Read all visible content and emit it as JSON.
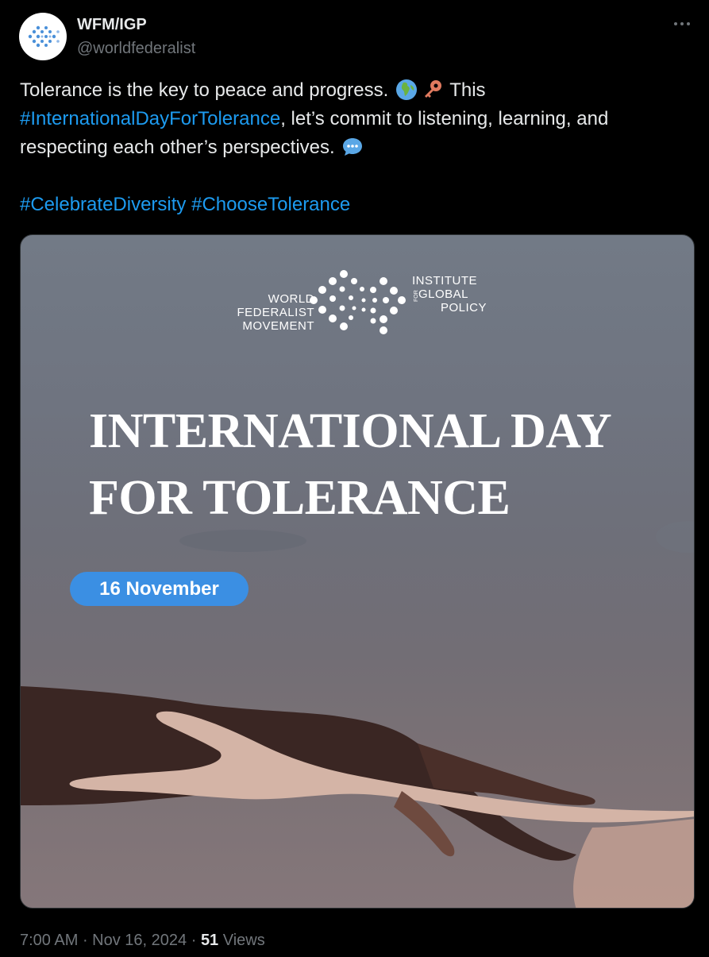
{
  "account": {
    "display_name": "WFM/IGP",
    "handle": "@worldfederalist"
  },
  "icons": {
    "avatar": "wfm-igp-logo-icon",
    "more": "more-options-icon",
    "emoji_1": "globe-africa-europe-icon",
    "emoji_2": "key-icon",
    "emoji_3": "speech-balloon-icon"
  },
  "text": {
    "line1_a": "Tolerance is the key to peace and progress.",
    "line1_b": "This",
    "line2_hashtag": "#InternationalDayForTolerance",
    "line2_rest": ", let’s commit to listening, learning, and",
    "line3": "respecting each other’s perspectives.",
    "hashtag_1": "#CelebrateDiversity",
    "hashtag_2": "#ChooseTolerance"
  },
  "media": {
    "logo_left_1": "WORLD",
    "logo_left_2": "FEDERALIST",
    "logo_left_3": "MOVEMENT",
    "logo_right_1": "INSTITUTE",
    "logo_right_2": "GLOBAL",
    "logo_right_3": "POLICY",
    "logo_for": "FOR",
    "headline_1": "INTERNATIONAL DAY",
    "headline_2": "FOR TOLERANCE",
    "date": "16 November"
  },
  "meta": {
    "time": "7:00 AM",
    "date": "Nov 16, 2024",
    "views_count": "51",
    "views_label": "Views",
    "separator": " · "
  },
  "colors": {
    "background": "#000000",
    "text": "#e7e9ea",
    "secondary": "#71767b",
    "link": "#1d9bf0",
    "date_pill": "#3b8fe3"
  }
}
